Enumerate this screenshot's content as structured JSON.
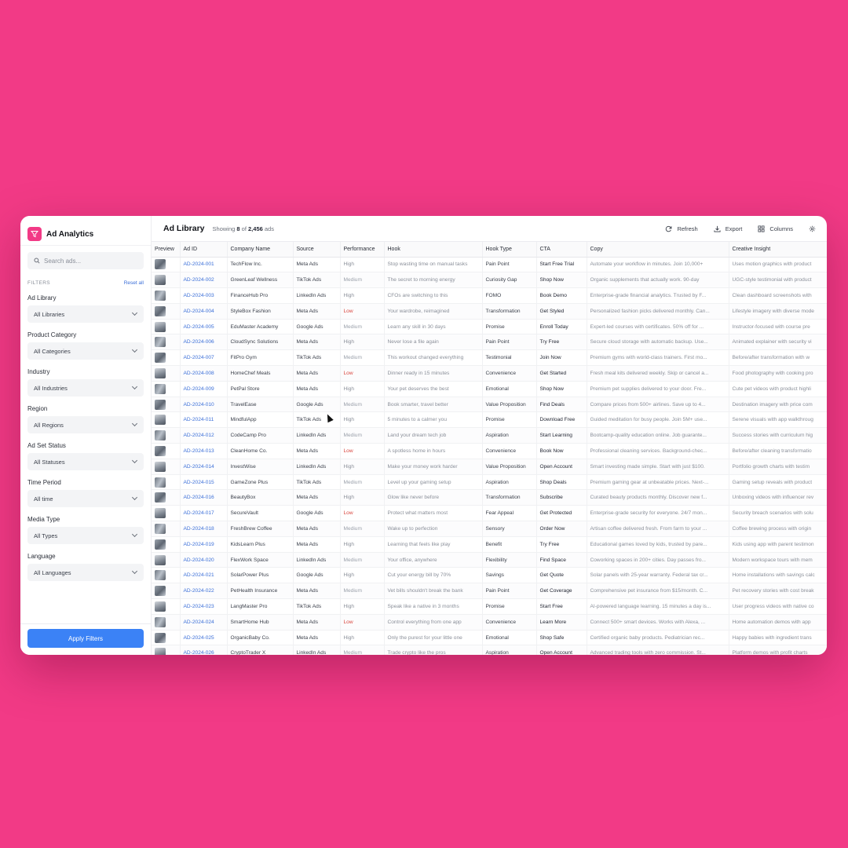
{
  "app": {
    "title": "Ad Analytics",
    "brand_color": "#f23a86",
    "accent_color": "#3b82f6"
  },
  "sidebar": {
    "search_placeholder": "Search ads...",
    "filters_label": "FILTERS",
    "reset_label": "Reset all",
    "filters": [
      {
        "label": "Ad Library",
        "value": "All Libraries"
      },
      {
        "label": "Product Category",
        "value": "All Categories"
      },
      {
        "label": "Industry",
        "value": "All Industries"
      },
      {
        "label": "Region",
        "value": "All Regions"
      },
      {
        "label": "Ad Set Status",
        "value": "All Statuses"
      },
      {
        "label": "Time Period",
        "value": "All time"
      },
      {
        "label": "Media Type",
        "value": "All Types"
      },
      {
        "label": "Language",
        "value": "All Languages"
      }
    ],
    "apply_label": "Apply Filters"
  },
  "header": {
    "title": "Ad Library",
    "showing_prefix": "Showing",
    "showing_count": "8",
    "showing_of": "of",
    "showing_total": "2,456",
    "showing_suffix": "ads",
    "refresh_label": "Refresh",
    "export_label": "Export",
    "columns_label": "Columns"
  },
  "table": {
    "columns": [
      "Preview",
      "Ad ID",
      "Company Name",
      "Source",
      "Performance",
      "Hook",
      "Hook Type",
      "CTA",
      "Copy",
      "Creative Insight"
    ],
    "rows": [
      [
        "AD-2024-001",
        "TechFlow Inc.",
        "Meta Ads",
        "High",
        "Stop wasting time on manual tasks",
        "Pain Point",
        "Start Free Trial",
        "Automate your workflow in minutes. Join 10,000+",
        "Uses motion graphics with product"
      ],
      [
        "AD-2024-002",
        "GreenLeaf Wellness",
        "TikTok Ads",
        "Medium",
        "The secret to morning energy",
        "Curiosity Gap",
        "Shop Now",
        "Organic supplements that actually work. 90-day",
        "UGC-style testimonial with product"
      ],
      [
        "AD-2024-003",
        "FinanceHub Pro",
        "LinkedIn Ads",
        "High",
        "CFOs are switching to this",
        "FOMO",
        "Book Demo",
        "Enterprise-grade financial analytics. Trusted by F...",
        "Clean dashboard screenshots with"
      ],
      [
        "AD-2024-004",
        "StyleBox Fashion",
        "Meta Ads",
        "Low",
        "Your wardrobe, reimagined",
        "Transformation",
        "Get Styled",
        "Personalized fashion picks delivered monthly. Can...",
        "Lifestyle imagery with diverse mode"
      ],
      [
        "AD-2024-005",
        "EduMaster Academy",
        "Google Ads",
        "Medium",
        "Learn any skill in 30 days",
        "Promise",
        "Enroll Today",
        "Expert-led courses with certificates. 50% off for ...",
        "Instructor-focused with course pre"
      ],
      [
        "AD-2024-006",
        "CloudSync Solutions",
        "Meta Ads",
        "High",
        "Never lose a file again",
        "Pain Point",
        "Try Free",
        "Secure cloud storage with automatic backup. Use...",
        "Animated explainer with security vi"
      ],
      [
        "AD-2024-007",
        "FitPro Gym",
        "TikTok Ads",
        "Medium",
        "This workout changed everything",
        "Testimonial",
        "Join Now",
        "Premium gyms with world-class trainers. First mo...",
        "Before/after transformation with w"
      ],
      [
        "AD-2024-008",
        "HomeChef Meals",
        "Meta Ads",
        "Low",
        "Dinner ready in 15 minutes",
        "Convenience",
        "Get Started",
        "Fresh meal kits delivered weekly. Skip or cancel a...",
        "Food photography with cooking pro"
      ],
      [
        "AD-2024-009",
        "PetPal Store",
        "Meta Ads",
        "High",
        "Your pet deserves the best",
        "Emotional",
        "Shop Now",
        "Premium pet supplies delivered to your door. Fre...",
        "Cute pet videos with product highli"
      ],
      [
        "AD-2024-010",
        "TravelEase",
        "Google Ads",
        "Medium",
        "Book smarter, travel better",
        "Value Proposition",
        "Find Deals",
        "Compare prices from 500+ airlines. Save up to 4...",
        "Destination imagery with price com"
      ],
      [
        "AD-2024-011",
        "MindfulApp",
        "TikTok Ads",
        "High",
        "5 minutes to a calmer you",
        "Promise",
        "Download Free",
        "Guided meditation for busy people. Join 5M+ use...",
        "Serene visuals with app walkthroug"
      ],
      [
        "AD-2024-012",
        "CodeCamp Pro",
        "LinkedIn Ads",
        "Medium",
        "Land your dream tech job",
        "Aspiration",
        "Start Learning",
        "Bootcamp-quality education online. Job guarante...",
        "Success stories with curriculum hig"
      ],
      [
        "AD-2024-013",
        "CleanHome Co.",
        "Meta Ads",
        "Low",
        "A spotless home in hours",
        "Convenience",
        "Book Now",
        "Professional cleaning services. Background-chec...",
        "Before/after cleaning transformatio"
      ],
      [
        "AD-2024-014",
        "InvestWise",
        "LinkedIn Ads",
        "High",
        "Make your money work harder",
        "Value Proposition",
        "Open Account",
        "Smart investing made simple. Start with just $100.",
        "Portfolio growth charts with testim"
      ],
      [
        "AD-2024-015",
        "GameZone Plus",
        "TikTok Ads",
        "Medium",
        "Level up your gaming setup",
        "Aspiration",
        "Shop Deals",
        "Premium gaming gear at unbeatable prices. Next-...",
        "Gaming setup reveals with product"
      ],
      [
        "AD-2024-016",
        "BeautyBox",
        "Meta Ads",
        "High",
        "Glow like never before",
        "Transformation",
        "Subscribe",
        "Curated beauty products monthly. Discover new f...",
        "Unboxing videos with influencer rev"
      ],
      [
        "AD-2024-017",
        "SecureVault",
        "Google Ads",
        "Low",
        "Protect what matters most",
        "Fear Appeal",
        "Get Protected",
        "Enterprise-grade security for everyone. 24/7 mon...",
        "Security breach scenarios with solu"
      ],
      [
        "AD-2024-018",
        "FreshBrew Coffee",
        "Meta Ads",
        "Medium",
        "Wake up to perfection",
        "Sensory",
        "Order Now",
        "Artisan coffee delivered fresh. From farm to your ...",
        "Coffee brewing process with origin"
      ],
      [
        "AD-2024-019",
        "KidsLearn Plus",
        "Meta Ads",
        "High",
        "Learning that feels like play",
        "Benefit",
        "Try Free",
        "Educational games loved by kids, trusted by pare...",
        "Kids using app with parent testimon"
      ],
      [
        "AD-2024-020",
        "FlexWork Space",
        "LinkedIn Ads",
        "Medium",
        "Your office, anywhere",
        "Flexibility",
        "Find Space",
        "Coworking spaces in 200+ cities. Day passes fro...",
        "Modern workspace tours with mem"
      ],
      [
        "AD-2024-021",
        "SolarPower Plus",
        "Google Ads",
        "High",
        "Cut your energy bill by 70%",
        "Savings",
        "Get Quote",
        "Solar panels with 25-year warranty. Federal tax cr...",
        "Home installations with savings calc"
      ],
      [
        "AD-2024-022",
        "PetHealth Insurance",
        "Meta Ads",
        "Medium",
        "Vet bills shouldn't break the bank",
        "Pain Point",
        "Get Coverage",
        "Comprehensive pet insurance from $15/month. C...",
        "Pet recovery stories with cost break"
      ],
      [
        "AD-2024-023",
        "LangMaster Pro",
        "TikTok Ads",
        "High",
        "Speak like a native in 3 months",
        "Promise",
        "Start Free",
        "AI-powered language learning. 15 minutes a day is...",
        "User progress videos with native co"
      ],
      [
        "AD-2024-024",
        "SmartHome Hub",
        "Meta Ads",
        "Low",
        "Control everything from one app",
        "Convenience",
        "Learn More",
        "Connect 500+ smart devices. Works with Alexa, ...",
        "Home automation demos with app"
      ],
      [
        "AD-2024-025",
        "OrganicBaby Co.",
        "Meta Ads",
        "High",
        "Only the purest for your little one",
        "Emotional",
        "Shop Safe",
        "Certified organic baby products. Pediatrician rec...",
        "Happy babies with ingredient trans"
      ],
      [
        "AD-2024-026",
        "CryptoTrader X",
        "LinkedIn Ads",
        "Medium",
        "Trade crypto like the pros",
        "Aspiration",
        "Open Account",
        "Advanced trading tools with zero commission. St...",
        "Platform demos with profit charts"
      ]
    ]
  }
}
